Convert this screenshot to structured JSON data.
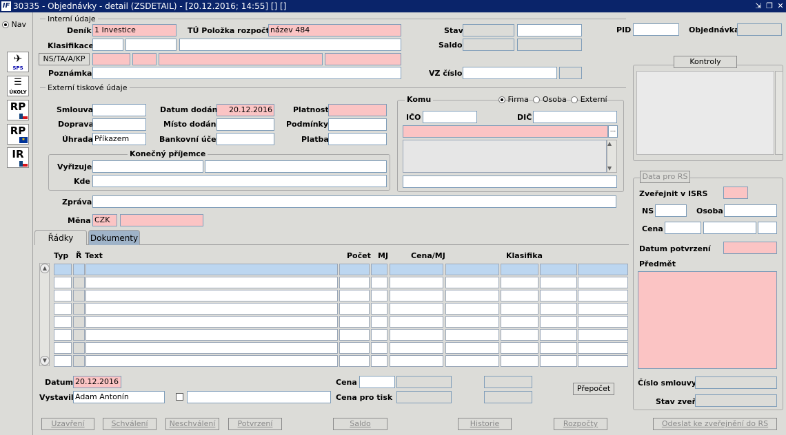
{
  "window": {
    "title": "30335 - Objednávky - detail (ZSDETAIL) - [20.12.2016; 14:55]  [] []",
    "logo": "IF"
  },
  "nav": {
    "label": "Nav"
  },
  "left_icons": [
    {
      "icon": "plane-sps-icon",
      "text": "SPS"
    },
    {
      "icon": "ukoly-icon",
      "text": "ÚKOLY"
    },
    {
      "icon": "rp-cz-icon",
      "text": "RP"
    },
    {
      "icon": "rp-eu-icon",
      "text": "RP"
    },
    {
      "icon": "ir-cz-icon",
      "text": "IR"
    }
  ],
  "interni": {
    "section": "Interní údaje",
    "denik_label": "Deník",
    "denik": "1 Investice",
    "tu_label": "TÚ Položka rozpočtu",
    "tu_value": "název 484",
    "klasifikace_label": "Klasifikace",
    "ns_button": "NS/TA/A/KP",
    "poznamka_label": "Poznámka",
    "stav_label": "Stav",
    "saldo_label": "Saldo",
    "vz_label": "VZ číslo",
    "pid_label": "PID",
    "objednavka_label": "Objednávka"
  },
  "externi": {
    "section": "Externí tiskové údaje",
    "smlouva_label": "Smlouva",
    "doprava_label": "Doprava",
    "uhrada_label": "Úhrada",
    "uhrada": "Příkazem",
    "datum_dodani_label": "Datum dodání",
    "datum_dodani": "20.12.2016",
    "misto_label": "Místo dodání",
    "ucet_label": "Bankovní účet",
    "platnost_label": "Platnost",
    "podminky_label": "Podmínky",
    "platba_label": "Platba",
    "prijemce_section": "Konečný příjemce",
    "vyrizuje_label": "Vyřizuje",
    "kde_label": "Kde",
    "zprava_label": "Zpráva",
    "mena_label": "Měna",
    "mena": "CZK"
  },
  "komu": {
    "section": "Komu",
    "options": [
      "Firma",
      "Osoba",
      "Externí"
    ],
    "ico_label": "IČO",
    "dic_label": "DIČ",
    "ellipsis": "..."
  },
  "kontroly": {
    "button": "Kontroly"
  },
  "rs": {
    "button": "Data pro RS",
    "zverejnit_label": "Zveřejnit v ISRS",
    "ns_label": "NS",
    "osoba_label": "Osoba",
    "cena_label": "Cena",
    "datum_potvrzeni_label": "Datum potvrzení",
    "predmet_label": "Předmět",
    "cislo_smlouvy_label": "Číslo smlouvy",
    "stav_zver_label": "Stav zveř."
  },
  "tabs": [
    {
      "label": "Řádky"
    },
    {
      "label": "Dokumenty"
    }
  ],
  "table": {
    "headers": [
      "Typ",
      "Ř",
      "Text",
      "Počet",
      "MJ",
      "Cena/MJ",
      "Klasifika"
    ]
  },
  "footer": {
    "datum_label": "Datum",
    "datum": "20.12.2016",
    "vystavil_label": "Vystavil",
    "vystavil": "Adam Antonín",
    "cena_label": "Cena",
    "cena_tisk_label": "Cena pro tisk",
    "prepocet": "Přepočet"
  },
  "bottom_buttons": [
    "Uzavření",
    "Schválení",
    "Neschválení",
    "Potvrzení",
    "Saldo",
    "Historie",
    "Rozpočty",
    "Odeslat ke zveřejnění do RS"
  ]
}
